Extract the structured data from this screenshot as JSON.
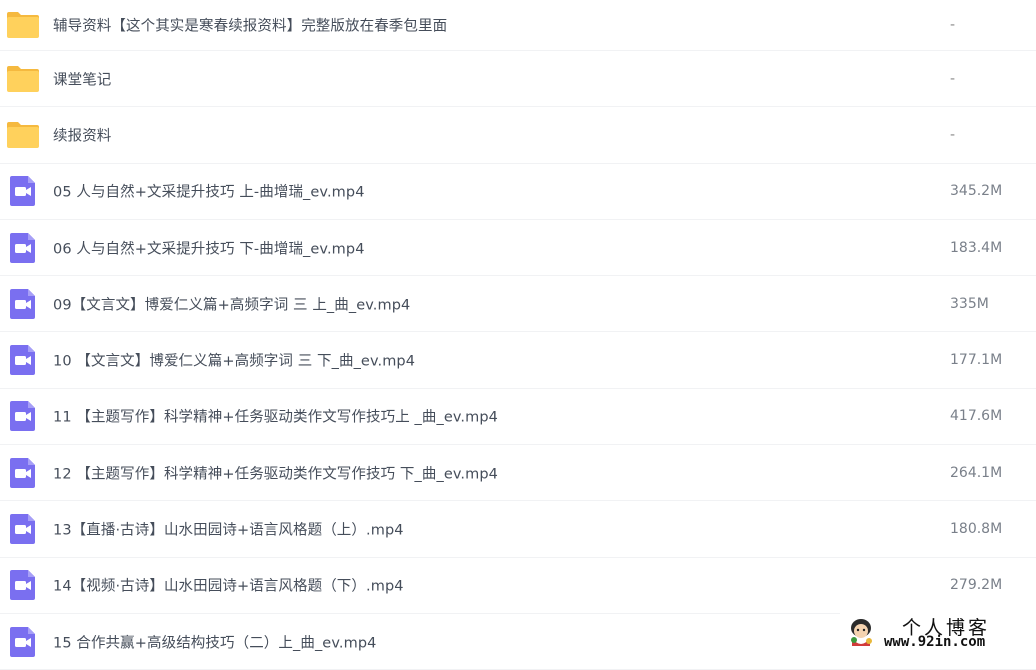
{
  "files": [
    {
      "kind": "folder",
      "name": "辅导资料【这个其实是寒春续报资料】完整版放在春季包里面",
      "size": "-"
    },
    {
      "kind": "folder",
      "name": "课堂笔记",
      "size": "-"
    },
    {
      "kind": "folder",
      "name": "续报资料",
      "size": "-"
    },
    {
      "kind": "video",
      "name": "05 人与自然+文采提升技巧 上-曲增瑞_ev.mp4",
      "size": "345.2M"
    },
    {
      "kind": "video",
      "name": "06 人与自然+文采提升技巧 下-曲增瑞_ev.mp4",
      "size": "183.4M"
    },
    {
      "kind": "video",
      "name": "09【文言文】博爱仁义篇+高频字词 三 上_曲_ev.mp4",
      "size": "335M"
    },
    {
      "kind": "video",
      "name": "10 【文言文】博爱仁义篇+高频字词 三 下_曲_ev.mp4",
      "size": "177.1M"
    },
    {
      "kind": "video",
      "name": "11 【主题写作】科学精神+任务驱动类作文写作技巧上 _曲_ev.mp4",
      "size": "417.6M"
    },
    {
      "kind": "video",
      "name": "12 【主题写作】科学精神+任务驱动类作文写作技巧 下_曲_ev.mp4",
      "size": "264.1M"
    },
    {
      "kind": "video",
      "name": "13【直播·古诗】山水田园诗+语言风格题（上）.mp4",
      "size": "180.8M"
    },
    {
      "kind": "video",
      "name": "14【视频·古诗】山水田园诗+语言风格题（下）.mp4",
      "size": "279.2M"
    },
    {
      "kind": "video",
      "name": "15 合作共赢+高级结构技巧（二）上_曲_ev.mp4",
      "size": ""
    }
  ],
  "icons": {
    "folder": "folder-icon",
    "video": "video-file-icon"
  },
  "colors": {
    "folder": "#ffd15c",
    "video": "#7a6ff0",
    "text": "#454d5a",
    "size": "#7a808a"
  },
  "watermark": {
    "title": "个人博客",
    "url": "www.92in.com"
  }
}
